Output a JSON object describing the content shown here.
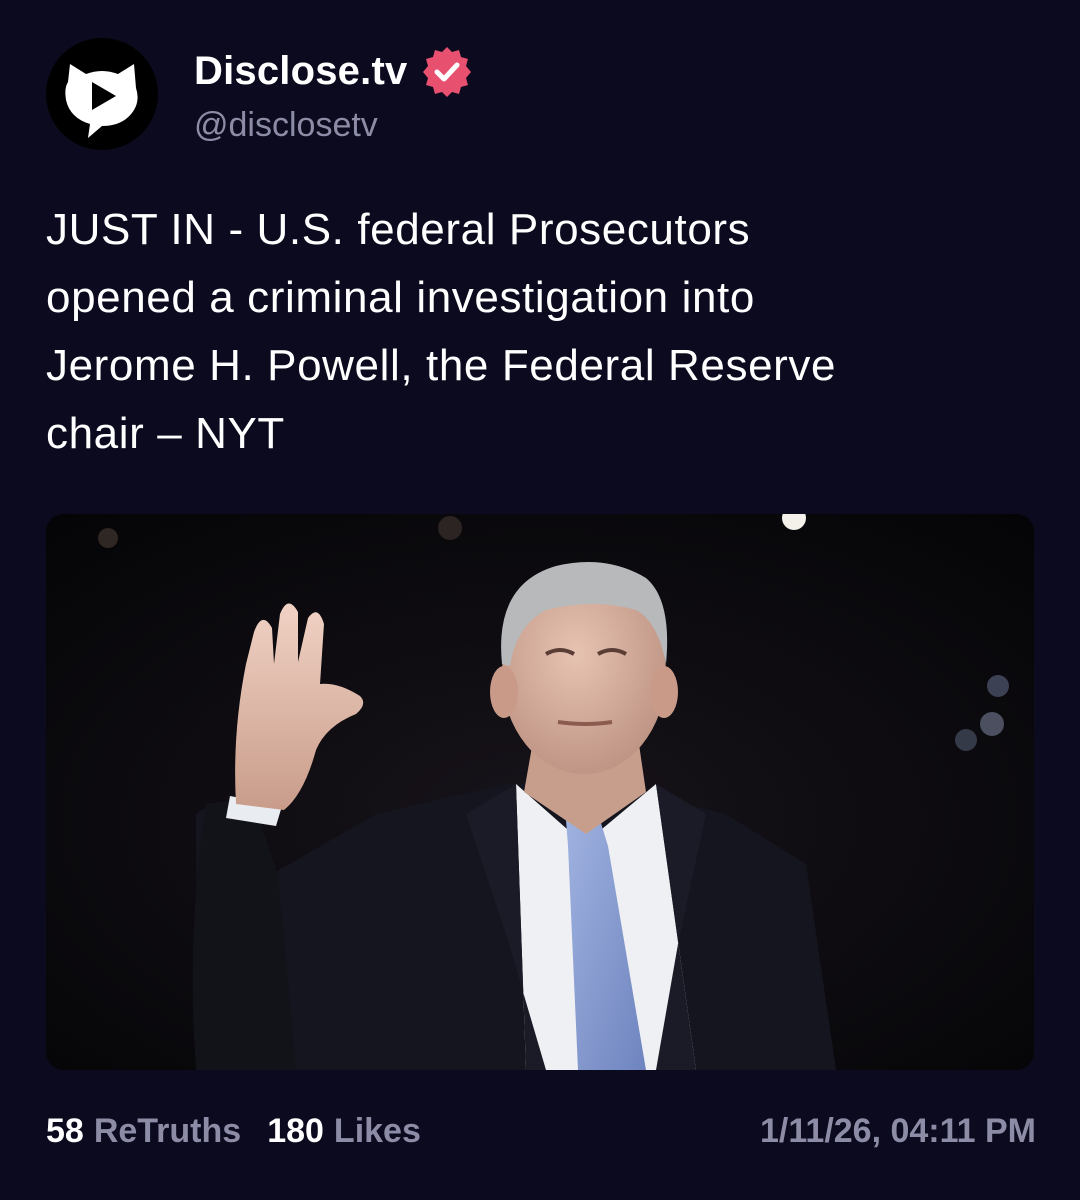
{
  "account": {
    "display_name": "Disclose.tv",
    "handle": "@disclosetv",
    "avatar_icon": "play-chat-bubble-icon",
    "verified_icon": "verified-badge-icon",
    "verified_color": "#e8506f"
  },
  "post": {
    "text": "JUST IN - U.S. federal Prosecutors\nopened a criminal investigation into\nJerome H. Powell, the Federal Reserve\nchair – NYT"
  },
  "stats": {
    "retruths_count": "58",
    "retruths_label": "ReTruths",
    "likes_count": "180",
    "likes_label": "Likes"
  },
  "timestamp": "1/11/26, 04:11 PM",
  "colors": {
    "background": "#0b0a1e",
    "text_primary": "#ffffff",
    "text_secondary": "#8c8ca6"
  }
}
